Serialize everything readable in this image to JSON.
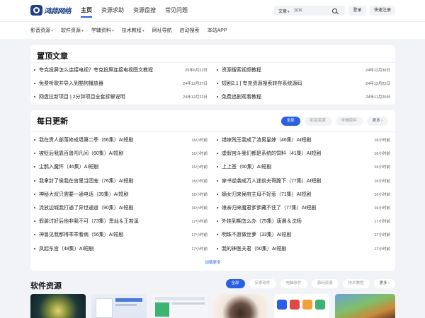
{
  "header": {
    "logo_text": "鸿蒜网络",
    "nav": [
      "主页",
      "资源求助",
      "资源盘搜",
      "常见问题"
    ],
    "search": {
      "type": "文章",
      "placeholder": "搜索"
    },
    "login_label": "登录",
    "register_label": "快速注册"
  },
  "categories": [
    {
      "label": "影音资源",
      "dropdown": true
    },
    {
      "label": "软件资源",
      "dropdown": true
    },
    {
      "label": "学辅资料",
      "dropdown": true
    },
    {
      "label": "技术教程",
      "dropdown": true
    },
    {
      "label": "网址导航",
      "dropdown": false
    },
    {
      "label": "启动搜索",
      "dropdown": false
    },
    {
      "label": "本站APP",
      "dropdown": false
    }
  ],
  "pinned": {
    "title": "置顶文章",
    "items": [
      {
        "title": "夸克投屏怎么连接电视？夸克投屏连接电视图文教程",
        "date": "25年6月22日"
      },
      {
        "title": "资源搜索视频教程",
        "date": "24年12月30日"
      },
      {
        "title": "免费听歌并导入到酷狗播放器",
        "date": "24年12月27日"
      },
      {
        "title": "短剧2.1 | 夸克资源搜索转存系统源码",
        "date": "24年12月22日"
      },
      {
        "title": "网盘拉新项目 | 2分钟项目全套拆解说明",
        "date": "24年12月22日"
      },
      {
        "title": "免费追剧观看教程",
        "date": "24年11月20日"
      }
    ]
  },
  "daily": {
    "title": "每日更新",
    "tabs": [
      "全部",
      "影音资源",
      "学辅资料",
      "更多"
    ],
    "items": [
      {
        "title": "我在贵人部落修成墙第二季（66集）AI短剧",
        "time": "16小时前"
      },
      {
        "title": "错嫁残王我成了渣男皇婶（46集）AI短剧",
        "time": "16小时前"
      },
      {
        "title": "被贬后我靠百兽闯凡间（60集）AI短剧",
        "time": "16小时前"
      },
      {
        "title": "虚假宫斗我们都是系统的饲料（41集）AI短剧",
        "time": "16小时前"
      },
      {
        "title": "尘鹊入魔怀（46集）AI短剧",
        "time": "16小时前"
      },
      {
        "title": "上上签（60集）AI短剧",
        "time": "16小时前"
      },
      {
        "title": "我拿封了侯我在宫里当团宠（76集）AI短剧",
        "time": "16小时前"
      },
      {
        "title": "穿书逆袭成万人迷前夫哥跪下（77集）AI短剧",
        "time": "16小时前"
      },
      {
        "title": "神秘大叔只需要一通电话（35集）AI短剧",
        "time": "16小时前"
      },
      {
        "title": "嫡女归来侯府主母不好惹（71集）AI短剧",
        "time": "16小时前"
      },
      {
        "title": "流放边城我打通了异世通道（90集）AI短剧",
        "time": "16小时前"
      },
      {
        "title": "娘亲归来魔君爹爹藏不住了（77集）AI短剧",
        "time": "16小时前"
      },
      {
        "title": "假装讨好后他非我不可（73集）恩灿＆王若溪",
        "time": "17小时前"
      },
      {
        "title": "外挂到期怎么办（75集）唐晨＆沈杨",
        "time": "17小时前"
      },
      {
        "title": "神兽见我都得乖乖看病（56集）AI短剧",
        "time": "17小时前"
      },
      {
        "title": "明珠不愿做丝萝（33集）AI短剧",
        "time": "17小时前"
      },
      {
        "title": "凤起东宫（48集）AI短剧",
        "time": "17小时前"
      },
      {
        "title": "我的神医夫君（50集）AI短剧",
        "time": "17小时前"
      }
    ],
    "load_more": "加载更多"
  },
  "software": {
    "title": "软件资源",
    "tabs": [
      "全部",
      "安卓软件",
      "电脑软件",
      "源码资源",
      "技术教程",
      "更多"
    ]
  },
  "colors": {
    "accent": "#2b5fe3",
    "logo": "#1f3f8a",
    "background": "#f2f3f7"
  }
}
